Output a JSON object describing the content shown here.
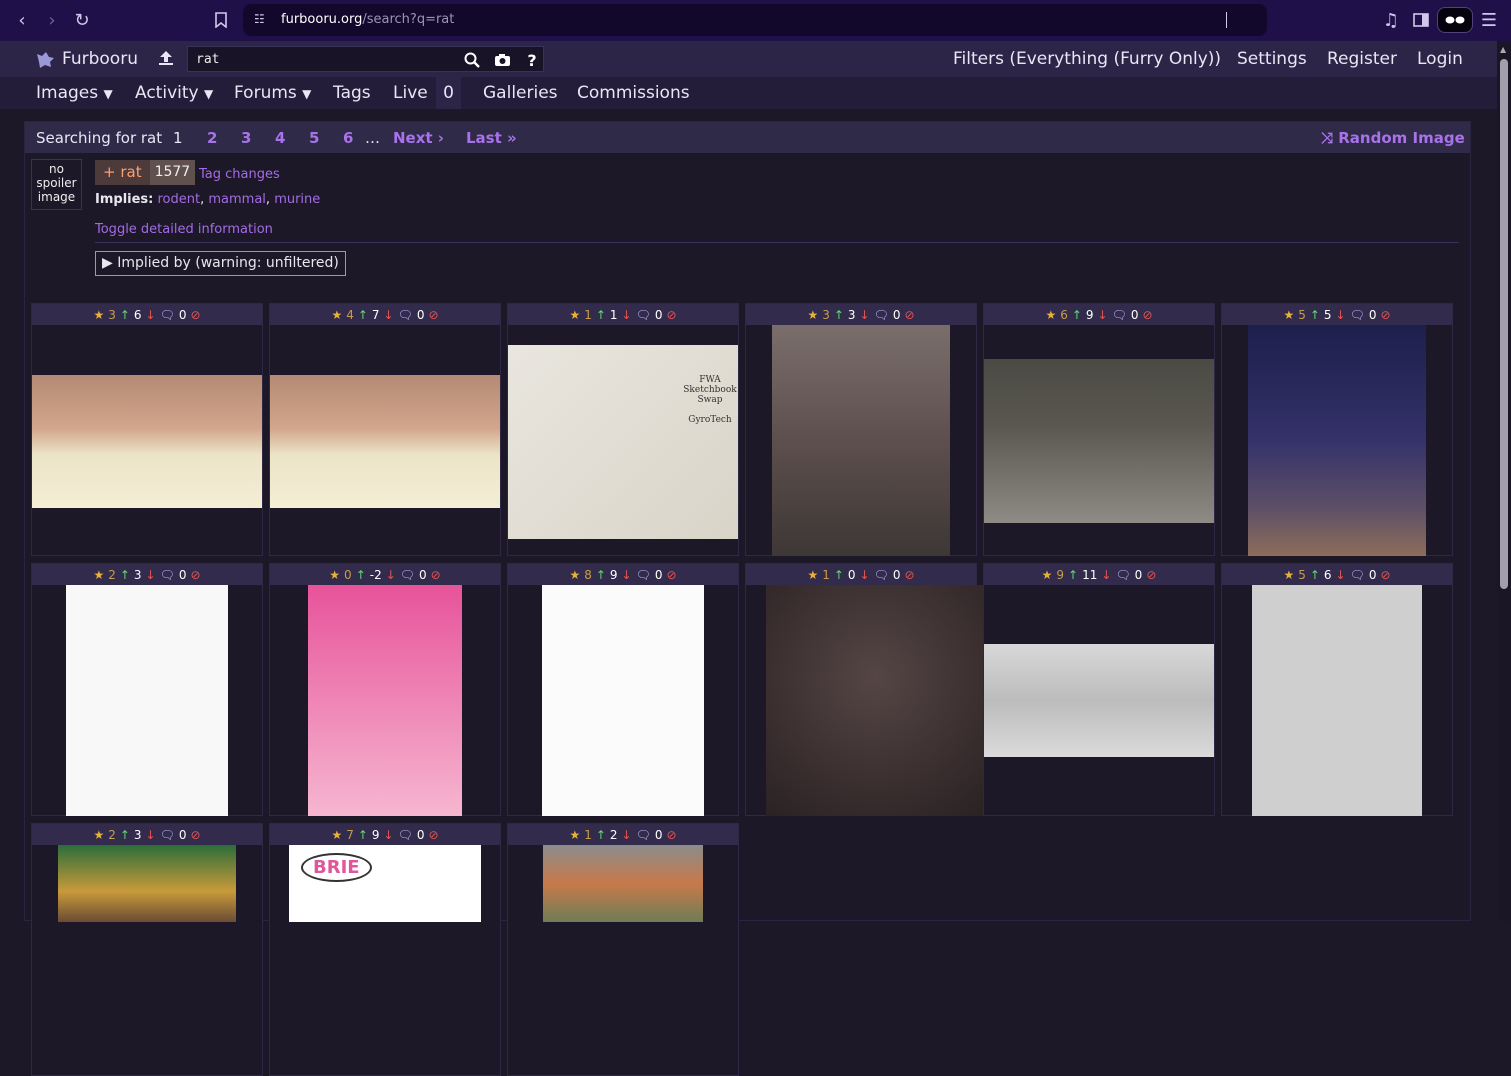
{
  "browser": {
    "url_domain": "furbooru.org",
    "url_path": "/search?q=rat"
  },
  "header": {
    "logo": "Furbooru",
    "search_value": "rat",
    "filters": "Filters (Everything (Furry Only))",
    "settings": "Settings",
    "register": "Register",
    "login": "Login"
  },
  "nav": {
    "images": "Images",
    "activity": "Activity",
    "forums": "Forums",
    "tags": "Tags",
    "live": "Live",
    "live_count": "0",
    "galleries": "Galleries",
    "commissions": "Commissions"
  },
  "searchbar": {
    "label": "Searching for rat",
    "pages": [
      "1",
      "2",
      "3",
      "4",
      "5",
      "6"
    ],
    "ellipsis": "…",
    "next": "Next ›",
    "last": "Last »",
    "random": "Random Image"
  },
  "tag": {
    "spoiler": [
      "no",
      "spoiler",
      "image"
    ],
    "name": "+ rat",
    "count": "1577",
    "changes": "Tag changes",
    "implies_label": "Implies:",
    "implies": [
      "rodent",
      "mammal",
      "murine"
    ],
    "toggle": "Toggle detailed information",
    "implied_by": "Implied by (warning: unfiltered)"
  },
  "thumbs": [
    {
      "stars": "3",
      "up": "6",
      "comments": "0"
    },
    {
      "stars": "4",
      "up": "7",
      "comments": "0"
    },
    {
      "stars": "1",
      "up": "1",
      "comments": "0"
    },
    {
      "stars": "3",
      "up": "3",
      "comments": "0"
    },
    {
      "stars": "6",
      "up": "9",
      "comments": "0"
    },
    {
      "stars": "5",
      "up": "5",
      "comments": "0"
    },
    {
      "stars": "2",
      "up": "3",
      "comments": "0"
    },
    {
      "stars": "0",
      "up": "-2",
      "comments": "0"
    },
    {
      "stars": "8",
      "up": "9",
      "comments": "0"
    },
    {
      "stars": "1",
      "up": "0",
      "comments": "0"
    },
    {
      "stars": "9",
      "up": "11",
      "comments": "0"
    },
    {
      "stars": "5",
      "up": "6",
      "comments": "0"
    },
    {
      "stars": "2",
      "up": "3",
      "comments": "0"
    },
    {
      "stars": "7",
      "up": "9",
      "comments": "0"
    },
    {
      "stars": "1",
      "up": "2",
      "comments": "0"
    }
  ],
  "image_text": {
    "sketch_title": "FWA Sketchbook Swap",
    "sketch_author": "GyroTech",
    "brie": "BRIE"
  }
}
